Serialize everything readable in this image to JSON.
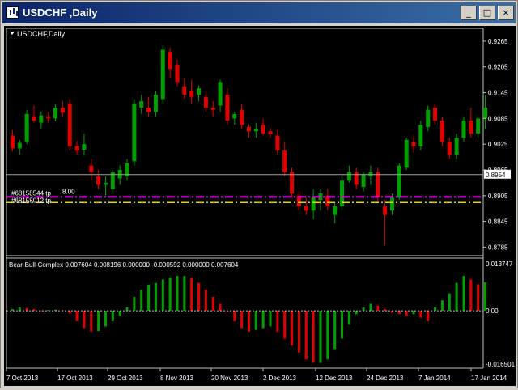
{
  "window": {
    "title": "USDCHF ,Daily"
  },
  "title_buttons": {
    "minimize": "_",
    "maximize": "□",
    "close": "×"
  },
  "main_panel": {
    "label": "USDCHF,Daily",
    "current_price": "0.8954",
    "price_ticks": [
      "0.9265",
      "0.9205",
      "0.9145",
      "0.9085",
      "0.9025",
      "0.8965",
      "0.8905",
      "0.8845",
      "0.8785"
    ],
    "order_labels": {
      "tp1": "#68158544 tp",
      "tp2": "#68158012 tp",
      "lot_value": "8.00"
    }
  },
  "sub_panel": {
    "label": "Bear-Bull-Complex 0.007604 0.008196 0.000000 -0.000592 0.000000 0.007604",
    "ticks": [
      "0.013747",
      "0.00",
      "-0.016501"
    ]
  },
  "x_axis": {
    "labels": [
      "7 Oct 2013",
      "17 Oct 2013",
      "29 Oct 2013",
      "8 Nov 2013",
      "20 Nov 2013",
      "2 Dec 2013",
      "12 Dec 2013",
      "24 Dec 2013",
      "7 Jan 2014",
      "17 Jan 2014"
    ]
  },
  "chart_data": {
    "type": "candlestick",
    "symbol": "USDCHF",
    "timeframe": "Daily",
    "y_range": [
      0.8765,
      0.9295
    ],
    "last_price": 0.8954,
    "order_levels": [
      {
        "label": "#68158544 tp",
        "price": 0.8902,
        "color": "#ff00ff"
      },
      {
        "label": "#68158012 tp",
        "price": 0.8889,
        "color": "#d8d800"
      }
    ],
    "ohlc": [
      [
        0.9045,
        0.9058,
        0.9008,
        0.9015
      ],
      [
        0.9015,
        0.9035,
        0.9,
        0.9028
      ],
      [
        0.903,
        0.9105,
        0.9025,
        0.9095
      ],
      [
        0.909,
        0.9115,
        0.9075,
        0.908
      ],
      [
        0.9075,
        0.9102,
        0.906,
        0.9092
      ],
      [
        0.909,
        0.91,
        0.9075,
        0.9085
      ],
      [
        0.9085,
        0.9118,
        0.9078,
        0.911
      ],
      [
        0.911,
        0.9125,
        0.909,
        0.9098
      ],
      [
        0.912,
        0.913,
        0.901,
        0.902
      ],
      [
        0.902,
        0.9032,
        0.9,
        0.901
      ],
      [
        0.9012,
        0.905,
        0.8998,
        0.9025
      ],
      [
        0.8975,
        0.899,
        0.894,
        0.896
      ],
      [
        0.895,
        0.8965,
        0.892,
        0.893
      ],
      [
        0.893,
        0.895,
        0.8905,
        0.8935
      ],
      [
        0.892,
        0.8965,
        0.891,
        0.896
      ],
      [
        0.8945,
        0.8975,
        0.893,
        0.8965
      ],
      [
        0.895,
        0.899,
        0.894,
        0.898
      ],
      [
        0.8985,
        0.913,
        0.8975,
        0.912
      ],
      [
        0.911,
        0.914,
        0.9095,
        0.9125
      ],
      [
        0.911,
        0.9135,
        0.909,
        0.91
      ],
      [
        0.91,
        0.915,
        0.909,
        0.914
      ],
      [
        0.913,
        0.9255,
        0.912,
        0.9245
      ],
      [
        0.924,
        0.925,
        0.918,
        0.92
      ],
      [
        0.921,
        0.9222,
        0.916,
        0.917
      ],
      [
        0.916,
        0.918,
        0.913,
        0.914
      ],
      [
        0.915,
        0.9175,
        0.912,
        0.9135
      ],
      [
        0.914,
        0.9162,
        0.9125,
        0.9155
      ],
      [
        0.9135,
        0.9148,
        0.91,
        0.911
      ],
      [
        0.911,
        0.9125,
        0.909,
        0.9105
      ],
      [
        0.9115,
        0.9175,
        0.91,
        0.917
      ],
      [
        0.914,
        0.9155,
        0.907,
        0.908
      ],
      [
        0.9085,
        0.91,
        0.907,
        0.9095
      ],
      [
        0.9105,
        0.912,
        0.906,
        0.907
      ],
      [
        0.9065,
        0.9072,
        0.904,
        0.9055
      ],
      [
        0.9055,
        0.9075,
        0.904,
        0.906
      ],
      [
        0.907,
        0.9085,
        0.9045,
        0.905
      ],
      [
        0.9055,
        0.9062,
        0.904,
        0.9048
      ],
      [
        0.9045,
        0.9058,
        0.9,
        0.901
      ],
      [
        0.901,
        0.903,
        0.895,
        0.896
      ],
      [
        0.896,
        0.897,
        0.89,
        0.891
      ],
      [
        0.8905,
        0.8915,
        0.887,
        0.888
      ],
      [
        0.888,
        0.89,
        0.886,
        0.887
      ],
      [
        0.887,
        0.892,
        0.885,
        0.89
      ],
      [
        0.8895,
        0.892,
        0.887,
        0.891
      ],
      [
        0.8905,
        0.892,
        0.887,
        0.888
      ],
      [
        0.886,
        0.889,
        0.884,
        0.888
      ],
      [
        0.888,
        0.895,
        0.887,
        0.894
      ],
      [
        0.894,
        0.8975,
        0.8935,
        0.896
      ],
      [
        0.896,
        0.897,
        0.892,
        0.893
      ],
      [
        0.8925,
        0.896,
        0.8915,
        0.8955
      ],
      [
        0.895,
        0.8975,
        0.893,
        0.896
      ],
      [
        0.896,
        0.897,
        0.889,
        0.89
      ],
      [
        0.888,
        0.8895,
        0.879,
        0.886
      ],
      [
        0.887,
        0.891,
        0.886,
        0.89
      ],
      [
        0.89,
        0.898,
        0.8895,
        0.8975
      ],
      [
        0.897,
        0.904,
        0.8965,
        0.9035
      ],
      [
        0.903,
        0.9045,
        0.9005,
        0.902
      ],
      [
        0.902,
        0.908,
        0.901,
        0.907
      ],
      [
        0.9065,
        0.9115,
        0.9055,
        0.9105
      ],
      [
        0.911,
        0.912,
        0.907,
        0.908
      ],
      [
        0.908,
        0.909,
        0.902,
        0.903
      ],
      [
        0.903,
        0.904,
        0.899,
        0.9
      ],
      [
        0.9,
        0.905,
        0.899,
        0.904
      ],
      [
        0.904,
        0.909,
        0.903,
        0.908
      ],
      [
        0.908,
        0.911,
        0.904,
        0.905
      ],
      [
        0.905,
        0.909,
        0.904,
        0.9085
      ],
      [
        0.9085,
        0.914,
        0.906,
        0.911
      ]
    ],
    "indicator": {
      "name": "Bear-Bull-Complex",
      "y_range": [
        -0.016501,
        0.013747
      ],
      "values": [
        0.0005,
        0.001,
        0.0008,
        0.0005,
        0.0001,
        0.0002,
        0.0003,
        0.0002,
        -0.0008,
        -0.003,
        -0.005,
        -0.006,
        -0.0058,
        -0.0045,
        -0.003,
        -0.0015,
        0.001,
        0.004,
        0.006,
        0.0075,
        0.008,
        0.009,
        0.0095,
        0.01,
        0.01,
        0.0095,
        0.008,
        0.006,
        0.004,
        0.002,
        0.0,
        -0.003,
        -0.005,
        -0.006,
        -0.0055,
        -0.005,
        -0.0045,
        -0.006,
        -0.008,
        -0.01,
        -0.012,
        -0.014,
        -0.015,
        -0.015,
        -0.014,
        -0.011,
        -0.008,
        -0.004,
        -0.001,
        0.001,
        0.002,
        0.0015,
        0.0005,
        -0.0005,
        -0.001,
        -0.0015,
        -0.001,
        -0.002,
        -0.003,
        0.001,
        0.003,
        0.005,
        0.008,
        0.01,
        0.009,
        0.0076,
        0.0082
      ],
      "up_color": "#00a000",
      "down_color": "#e00000"
    }
  },
  "colors": {
    "background": "#000000",
    "bull": "#00a000",
    "bear": "#e00000",
    "axis_text": "#ffffff",
    "price_line": "#a0a0a0"
  }
}
